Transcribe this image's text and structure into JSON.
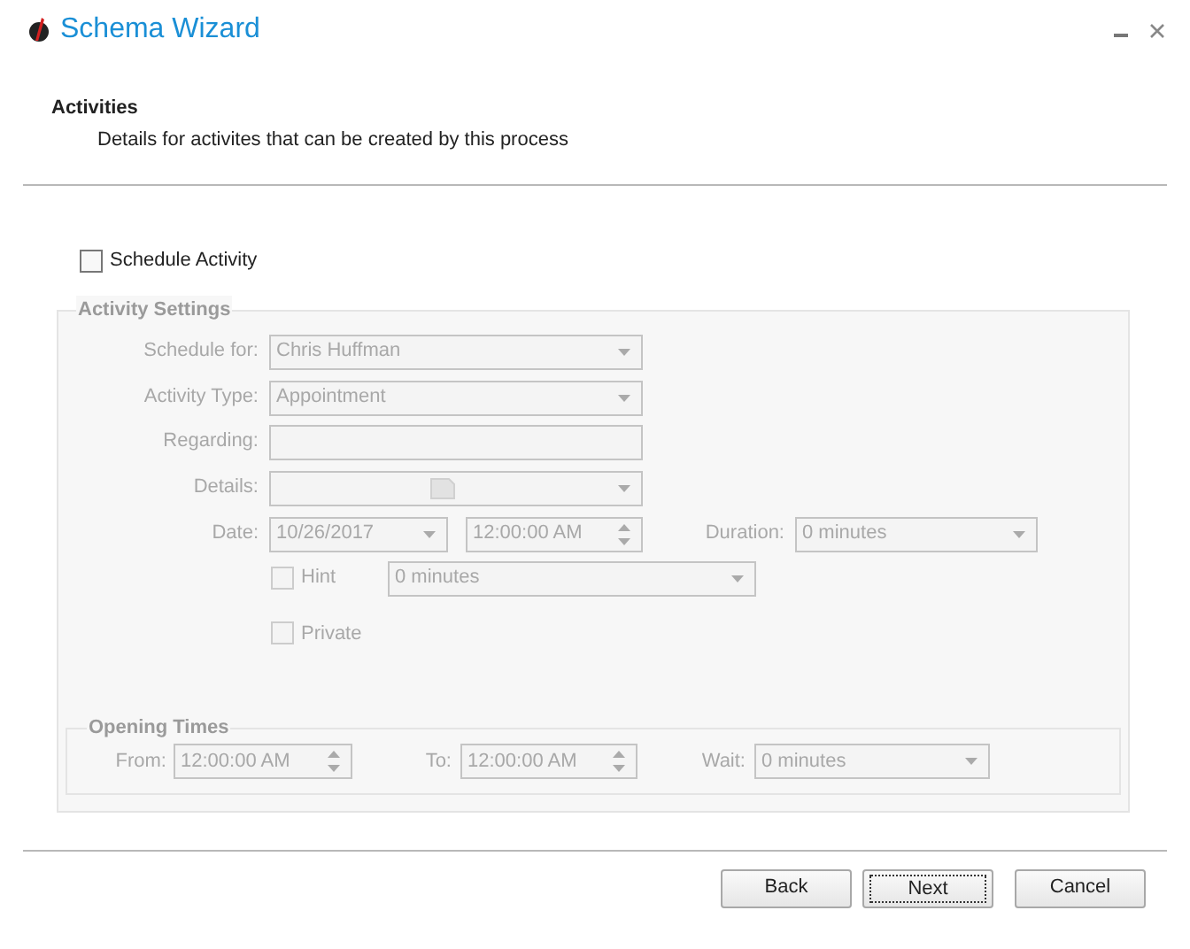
{
  "window": {
    "title": "Schema Wizard"
  },
  "header": {
    "title": "Activities",
    "subtitle": "Details for activites that can be created by this process"
  },
  "schedule_activity": {
    "label": "Schedule Activity",
    "checked": false
  },
  "activity_settings": {
    "legend": "Activity Settings",
    "disabled": true,
    "schedule_for": {
      "label": "Schedule for:",
      "value": "Chris Huffman"
    },
    "activity_type": {
      "label": "Activity Type:",
      "value": "Appointment"
    },
    "regarding": {
      "label": "Regarding:"
    },
    "details": {
      "label": "Details:"
    },
    "date": {
      "label": "Date:",
      "value": "10/26/2017",
      "time": "12:00:00 AM"
    },
    "duration": {
      "label": "Duration:",
      "value": "0 minutes"
    },
    "hint": {
      "label": "Hint",
      "checked": false,
      "value": "0 minutes"
    },
    "private": {
      "label": "Private",
      "checked": false
    },
    "opening_times": {
      "legend": "Opening Times",
      "from": {
        "label": "From:",
        "value": "12:00:00 AM"
      },
      "to": {
        "label": "To:",
        "value": "12:00:00 AM"
      },
      "wait": {
        "label": "Wait:",
        "value": "0 minutes"
      }
    }
  },
  "buttons": [
    {
      "label": "Back",
      "focused": false
    },
    {
      "label": "Next",
      "focused": true
    },
    {
      "label": "Cancel",
      "focused": false
    }
  ]
}
